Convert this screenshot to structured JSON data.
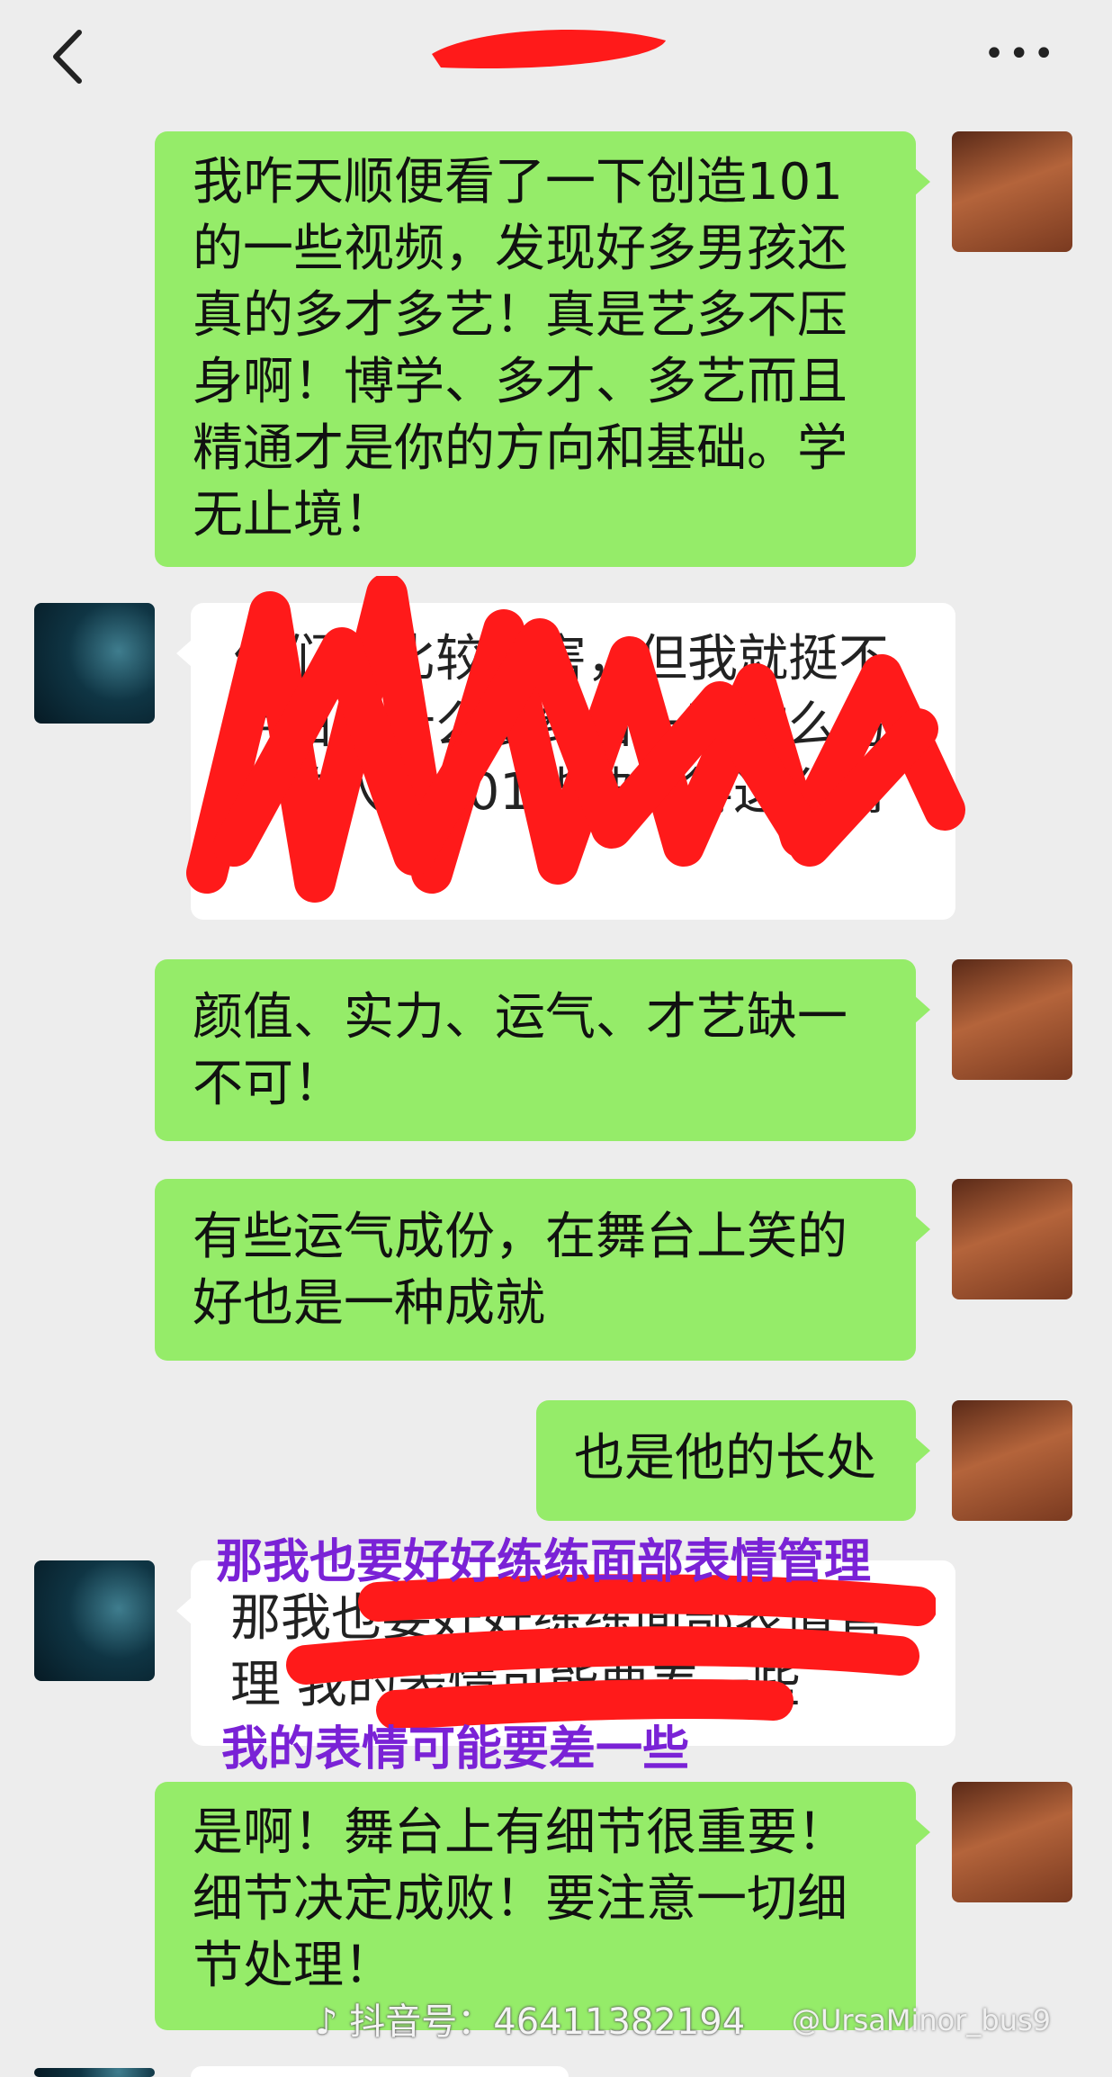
{
  "header": {
    "back_icon": "chevron-left-icon",
    "more_icon": "ellipsis-icon"
  },
  "messages": [
    {
      "side": "me",
      "text": "我咋天顺便看了一下创造101的一些视频，发现好多男孩还真的多才多艺！真是艺多不压身啊！博学、多才、多艺而且精通才是你的方向和基础。学无止境！"
    },
    {
      "side": "other",
      "text": "他们都比较厉害，但我就挺不明白为什么要结合一下这么厉害的人让101能被捧得这么高"
    },
    {
      "side": "me",
      "text": "颜值、实力、运气、才艺缺一不可！"
    },
    {
      "side": "me",
      "text": "有些运气成份，在舞台上笑的好也是一种成就"
    },
    {
      "side": "me",
      "text": "也是他的长处"
    },
    {
      "side": "other",
      "text": "那我也要好好练练面部表情管理 我的表情可能要差一些"
    },
    {
      "side": "me",
      "text": "是啊！舞台上有细节很重要！细节决定成败！要注意一切细节处理！"
    }
  ],
  "overlays": {
    "line1": "那我也要好好练练面部表情管理",
    "line2": "我的表情可能要差一些"
  },
  "watermarks": {
    "douyin": "抖音号：46411382194",
    "weibo": "@UrsaMinor_bus9"
  },
  "colors": {
    "me_bubble": "#95ec69",
    "other_bubble": "#ffffff",
    "background": "#ededed",
    "overlay_text": "#7a22d6",
    "redaction": "#ff1a1a"
  }
}
